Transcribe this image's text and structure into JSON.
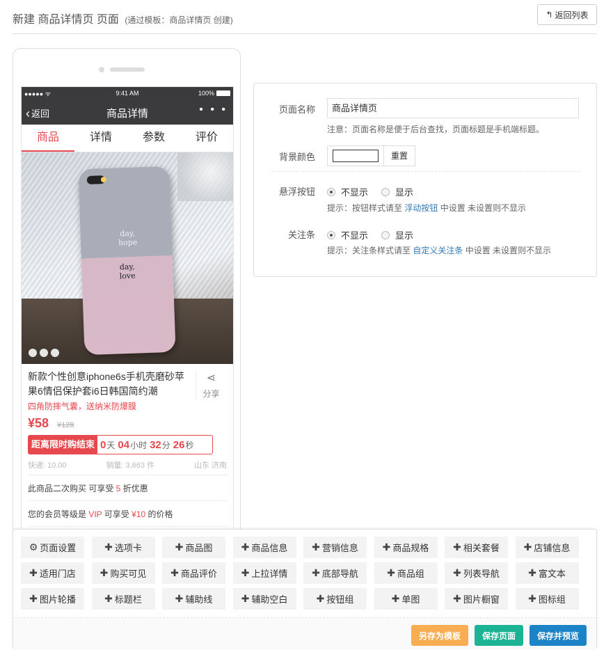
{
  "header": {
    "title": "新建 商品详情页 页面",
    "subtitle": "(通过模板：商品详情页 创建)",
    "back_label": "返回列表"
  },
  "phone": {
    "status": {
      "signal": "●●●●● ",
      "time": "9:41 AM",
      "battery": "100%"
    },
    "nav": {
      "back": "返回",
      "title": "商品详情",
      "more": "• • •"
    },
    "tabs": [
      "商品",
      "详情",
      "参数",
      "评价"
    ],
    "image_text": {
      "line1a": "day,",
      "line1b": "hope",
      "line2a": "day,",
      "line2b": "love"
    },
    "product": {
      "name": "新款个性创意iphone6s手机壳磨砂苹果6情侣保护套i6日韩国简约潮",
      "share_label": "分享",
      "subtitle": "四角防摔气囊，送纳米防爆膜",
      "price": "¥58",
      "old_price": "¥128",
      "countdown": {
        "label": "距离限时购结束",
        "days": "0",
        "days_unit": "天",
        "hours": "04",
        "hours_unit": "小时",
        "minutes": "32",
        "minutes_unit": "分",
        "seconds": "26",
        "seconds_unit": "秒"
      },
      "shipping": "快递: 10.00",
      "sales": "销量: 3,663 件",
      "location": "山东 济南"
    },
    "promo1": {
      "pre": "此商品二次购买 可享受 ",
      "num": "5",
      "post": " 折优惠"
    },
    "promo2": {
      "pre": "您的会员等级是 ",
      "vip": "VIP",
      "mid": " 可享受 ",
      "price": "¥10",
      "post": " 的价格"
    }
  },
  "form": {
    "page_name_label": "页面名称",
    "page_name_value": "商品详情页",
    "page_name_hint": "注意：页面名称是便于后台查找，页面标题是手机端标题。",
    "bg_color_label": "背景颜色",
    "bg_color_value": "#ffffff",
    "reset_label": "重置",
    "float_label": "悬浮按钮",
    "float_options": [
      "不显示",
      "显示"
    ],
    "float_selected": "不显示",
    "float_hint_pre": "提示：按钮样式请至 ",
    "float_hint_link": "浮动按钮",
    "float_hint_post": " 中设置 未设置则不显示",
    "follow_label": "关注条",
    "follow_options": [
      "不显示",
      "显示"
    ],
    "follow_selected": "不显示",
    "follow_hint_pre": "提示：关注条样式请至 ",
    "follow_hint_link": "自定义关注条",
    "follow_hint_post": " 中设置 未设置则不显示"
  },
  "components": [
    "页面设置",
    "选项卡",
    "商品图",
    "商品信息",
    "营销信息",
    "商品规格",
    "相关套餐",
    "店铺信息",
    "适用门店",
    "购买可见",
    "商品评价",
    "上拉详情",
    "底部导航",
    "商品组",
    "列表导航",
    "富文本",
    "图片轮播",
    "标题栏",
    "辅助线",
    "辅助空白",
    "按钮组",
    "单图",
    "图片橱窗",
    "图标组"
  ],
  "footer_buttons": {
    "save_template": "另存为模板",
    "save_page": "保存页面",
    "save_preview": "保存并预览"
  },
  "colors": {
    "accent_red": "#e5484d",
    "orange": "#f8ad52",
    "green": "#1bb394",
    "blue": "#1c84c6",
    "link": "#337ab7"
  }
}
